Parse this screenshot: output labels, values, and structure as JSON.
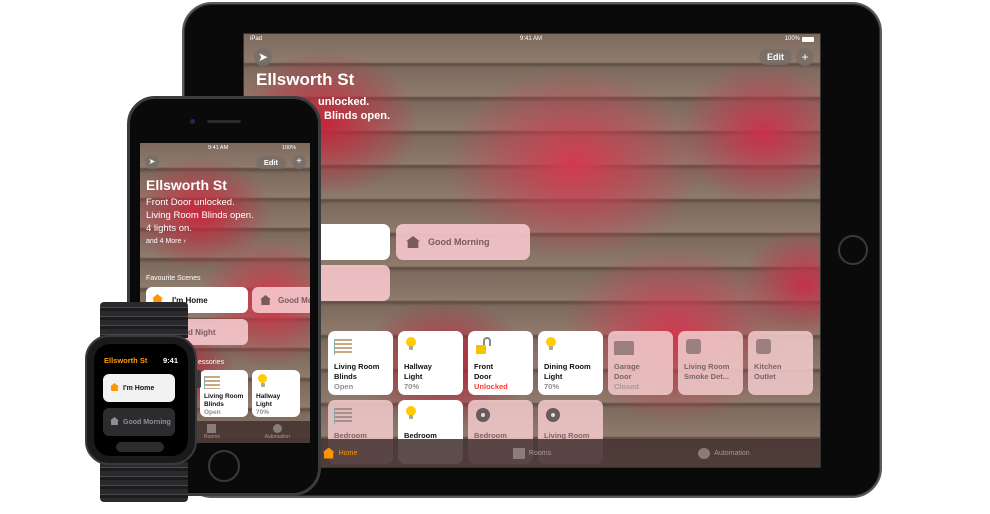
{
  "ipad": {
    "status": {
      "carrier": "iPad",
      "time": "9:41 AM",
      "battery": "100%"
    },
    "header": {
      "location_icon": "location-arrow-icon",
      "edit_label": "Edit",
      "add_label": "+"
    },
    "title": "Ellsworth St",
    "summary": [
      "Front Door unlocked.",
      "Living Room Blinds open."
    ],
    "summary_visible": [
      "unlocked.",
      "Blinds open."
    ],
    "scenes": [
      {
        "label": "I'm Home",
        "active": true
      },
      {
        "label": "Good Morning",
        "active": false
      },
      {
        "label": "Good Night",
        "active": false
      }
    ],
    "scene_partial_label": "ht",
    "section_accessories": "Favourite Accessories",
    "section_accessories_visible": "ries",
    "accessories": [
      {
        "name": "Living Room Blinds",
        "line1": "Living Room",
        "line2": "Blinds",
        "state": "Open",
        "icon": "blinds-icon",
        "active": true
      },
      {
        "name": "Hallway Light",
        "line1": "Hallway",
        "line2": "Light",
        "state": "70%",
        "icon": "bulb-icon",
        "active": true
      },
      {
        "name": "Front Door",
        "line1": "Front",
        "line2": "Door",
        "state": "Unlocked",
        "icon": "lock-icon",
        "active": true,
        "alert": true
      },
      {
        "name": "Dining Room Light",
        "line1": "Dining Room",
        "line2": "Light",
        "state": "70%",
        "icon": "bulb-icon",
        "active": true
      },
      {
        "name": "Garage Door",
        "line1": "Garage",
        "line2": "Door",
        "state": "Closed",
        "icon": "garage-icon",
        "active": false
      },
      {
        "name": "Living Room Smoke Detector",
        "line1": "Living Room",
        "line2": "Smoke Det...",
        "state": "",
        "icon": "smoke-detector-icon",
        "active": false
      },
      {
        "name": "Kitchen Outlet",
        "line1": "Kitchen",
        "line2": "Outlet",
        "state": "",
        "icon": "outlet-icon",
        "active": false
      },
      {
        "name": "Bedroom Blinds",
        "line1": "Bedroom",
        "line2": "",
        "state": "",
        "icon": "blinds-icon",
        "active": false
      },
      {
        "name": "Bedroom Light",
        "line1": "Bedroom",
        "line2": "",
        "state": "",
        "icon": "bulb-icon",
        "active": true
      },
      {
        "name": "Bedroom Fan",
        "line1": "Bedroom",
        "line2": "",
        "state": "",
        "icon": "fan-icon",
        "active": false
      },
      {
        "name": "Living Room Fan",
        "line1": "Living Room",
        "line2": "",
        "state": "",
        "icon": "fan-icon",
        "active": false
      }
    ],
    "tabs": [
      {
        "label": "Home",
        "icon": "home-icon",
        "active": true
      },
      {
        "label": "Rooms",
        "icon": "rooms-icon",
        "active": false
      },
      {
        "label": "Automation",
        "icon": "automation-icon",
        "active": false
      }
    ]
  },
  "iphone": {
    "status": {
      "time": "9:41 AM",
      "battery": "100%"
    },
    "header": {
      "edit_label": "Edit",
      "add_label": "+"
    },
    "title": "Ellsworth St",
    "summary": [
      "Front Door unlocked.",
      "Living Room Blinds open.",
      "4 lights on."
    ],
    "more_link": "and 4 More ›",
    "section_scenes": "Favourite Scenes",
    "scenes": [
      {
        "label": "I'm Home",
        "active": true
      },
      {
        "label": "Good Mo",
        "active": false
      },
      {
        "label": "Good Night",
        "active": false
      }
    ],
    "section_accessories": "Accessories",
    "section_accessories_visible": "essories",
    "accessories": [
      {
        "line1": "Living Room",
        "line2": "Blinds",
        "state": "Open",
        "icon": "blinds-icon"
      },
      {
        "line1": "Hallway",
        "line2": "Light",
        "state": "70%",
        "icon": "bulb-icon"
      }
    ],
    "tabs": [
      {
        "label": "Rooms",
        "icon": "rooms-icon"
      },
      {
        "label": "Automation",
        "icon": "automation-icon"
      }
    ]
  },
  "watch": {
    "title": "Ellsworth St",
    "time": "9:41",
    "scenes": [
      {
        "label": "I'm Home",
        "active": true
      },
      {
        "label": "Good Morning",
        "active": false
      }
    ]
  }
}
